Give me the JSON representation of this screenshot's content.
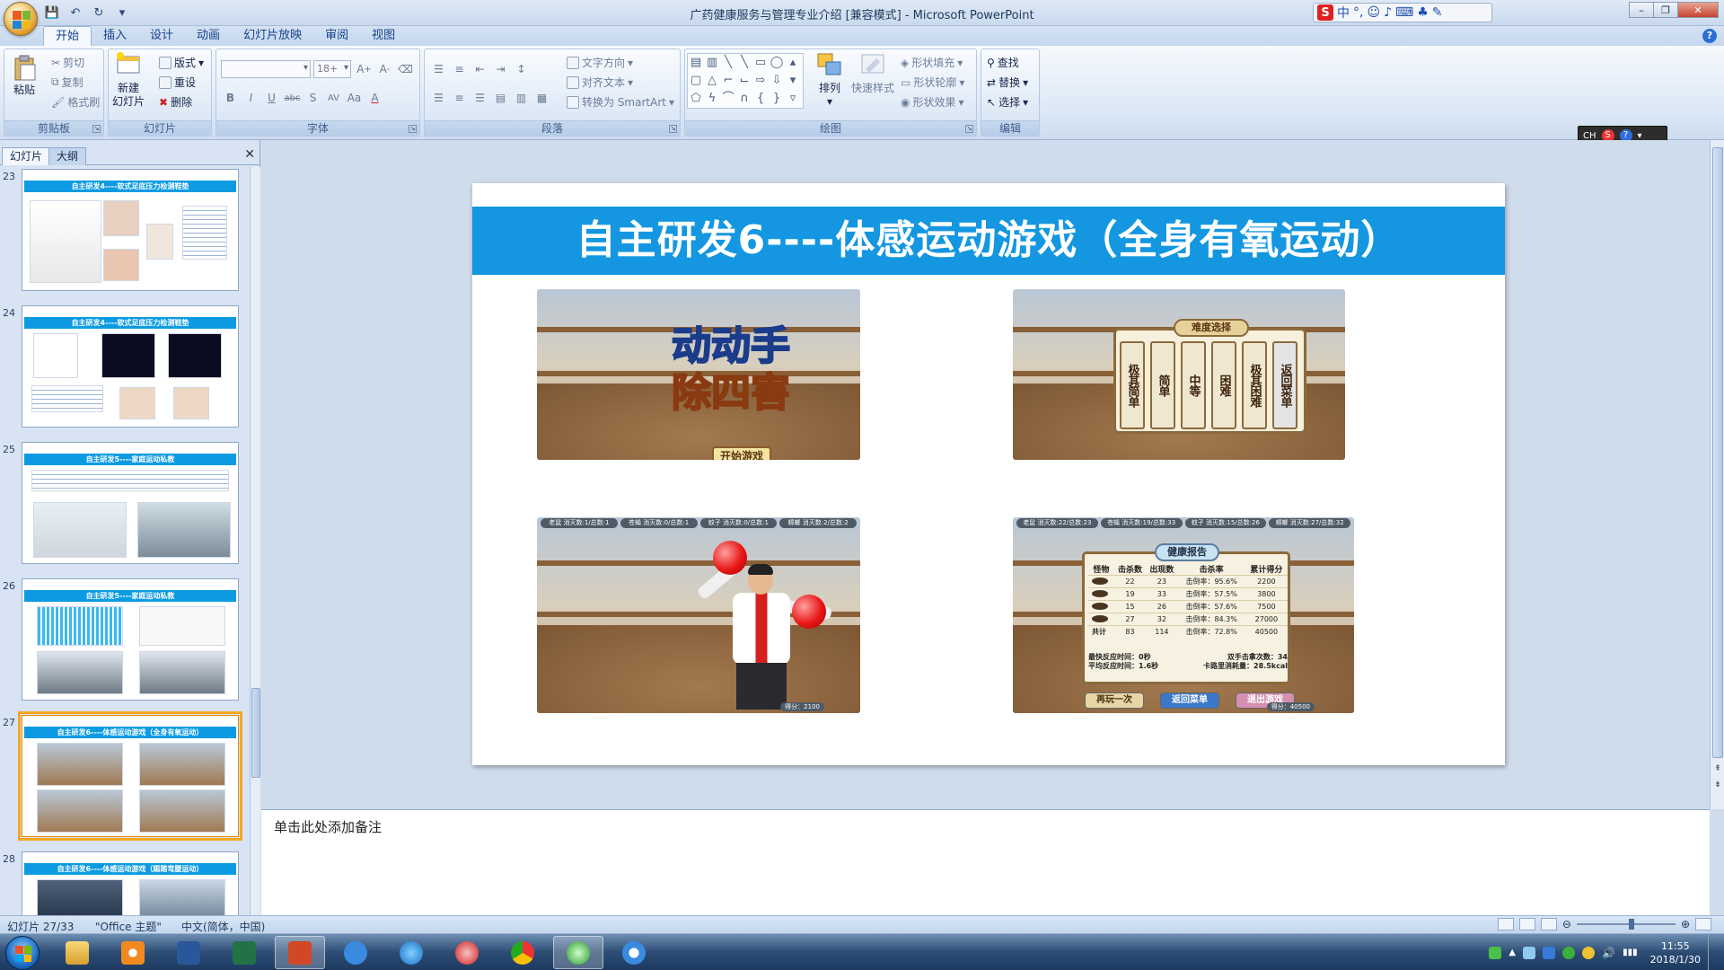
{
  "window": {
    "title": "广药健康服务与管理专业介绍 [兼容模式] - Microsoft PowerPoint"
  },
  "qat": [
    "save-icon",
    "undo-icon",
    "redo-icon",
    "customize-icon"
  ],
  "ribbon_tabs": [
    "开始",
    "插入",
    "设计",
    "动画",
    "幻灯片放映",
    "审阅",
    "视图"
  ],
  "active_tab": "开始",
  "ribbon": {
    "clipboard": {
      "label": "剪贴板",
      "paste": "粘贴",
      "cut": "剪切",
      "copy": "复制",
      "format_painter": "格式刷"
    },
    "slides": {
      "label": "幻灯片",
      "new_slide_1": "新建",
      "new_slide_2": "幻灯片",
      "layout": "版式",
      "reset": "重设",
      "delete": "删除"
    },
    "font": {
      "label": "字体",
      "size": "18+",
      "b": "B",
      "i": "I",
      "u": "U",
      "abc": "abc",
      "s": "S",
      "av": "AV",
      "aa": "Aa",
      "a": "A"
    },
    "paragraph": {
      "label": "段落",
      "text_direction": "文字方向",
      "align_text": "对齐文本",
      "smartart": "转换为 SmartArt"
    },
    "drawing": {
      "label": "绘图",
      "arrange": "排列",
      "quick_styles": "快速样式",
      "shape_fill": "形状填充",
      "shape_outline": "形状轮廓",
      "shape_effects": "形状效果"
    },
    "editing": {
      "label": "编辑",
      "find": "查找",
      "replace": "替换",
      "select": "选择"
    }
  },
  "ime": {
    "label": "中",
    "extra": "°,"
  },
  "minitoolbar": {
    "lang": "CH"
  },
  "left_pane": {
    "tabs": [
      "幻灯片",
      "大纲"
    ],
    "thumbnails": [
      {
        "num": "23",
        "title": "自主研发4----软式足底压力检测鞋垫"
      },
      {
        "num": "24",
        "title": "自主研发4----软式足底压力检测鞋垫"
      },
      {
        "num": "25",
        "title": "自主研发5----家庭运动私教"
      },
      {
        "num": "26",
        "title": "自主研发5----家庭运动私教"
      },
      {
        "num": "27",
        "title": "自主研发6----体感运动游戏（全身有氧运动）"
      },
      {
        "num": "28",
        "title": "自主研发6----体感运动游戏（踢踏弯腰运动）"
      }
    ],
    "selected": "27"
  },
  "slide": {
    "title": "自主研发6----体感运动游戏（全身有氧运动）",
    "game_logo_1": "动动手",
    "game_logo_2": "除四害",
    "start_button": "开始游戏",
    "difficulty_title": "难度选择",
    "difficulties": [
      "极其简单",
      "简单",
      "中等",
      "困难",
      "极其困难",
      "返回菜单"
    ],
    "hud": [
      "老鼠 消灭数:1/总数:1",
      "苍蝇 消灭数:0/总数:1",
      "蚊子 消灭数:0/总数:1",
      "蟑螂 消灭数:2/总数:2"
    ],
    "hud2": [
      "老鼠 消灭数:22/总数:23",
      "苍蝇 消灭数:19/总数:33",
      "蚊子 消灭数:15/总数:26",
      "蟑螂 消灭数:27/总数:32"
    ],
    "report": {
      "title": "健康报告",
      "headers": [
        "怪物",
        "击杀数",
        "出现数",
        "击杀率",
        "累计得分"
      ],
      "rows": [
        [
          "",
          "22",
          "23",
          "击倒率：95.6%",
          "2200"
        ],
        [
          "",
          "19",
          "33",
          "击倒率：57.5%",
          "3800"
        ],
        [
          "",
          "15",
          "26",
          "击倒率：57.6%",
          "7500"
        ],
        [
          "",
          "27",
          "32",
          "击倒率：84.3%",
          "27000"
        ],
        [
          "共计",
          "83",
          "114",
          "击倒率：72.8%",
          "40500"
        ]
      ],
      "fast_reaction": "最快反应时间：",
      "fast_value": "0秒",
      "avg_reaction": "平均反应时间：",
      "avg_value": "1.6秒",
      "double_hits": "双手击拿次数：",
      "double_value": "34",
      "calories": "卡路里消耗量：",
      "calories_value": "28.5kcal",
      "buttons": [
        "再玩一次",
        "返回菜单",
        "退出游戏"
      ],
      "score_1": "得分：2100",
      "score_2": "得分：40500"
    }
  },
  "notes": {
    "placeholder": "单击此处添加备注"
  },
  "statusbar": {
    "slide_count": "幻灯片 27/33",
    "theme": "\"Office 主题\"",
    "language": "中文(简体，中国)"
  },
  "taskbar": {
    "time": "11:55",
    "date": "2018/1/30"
  }
}
